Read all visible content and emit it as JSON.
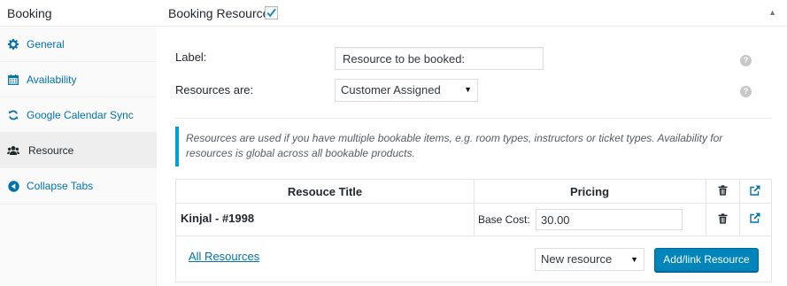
{
  "sidebar": {
    "title": "Booking",
    "tabs": [
      {
        "label": "General",
        "icon": "gear-icon"
      },
      {
        "label": "Availability",
        "icon": "calendar-icon"
      },
      {
        "label": "Google Calendar Sync",
        "icon": "sync-icon"
      },
      {
        "label": "Resource",
        "icon": "users-icon",
        "active": true
      },
      {
        "label": "Collapse Tabs",
        "icon": "collapse-arrow-icon"
      }
    ]
  },
  "header": {
    "title": "Booking Resource:",
    "checked": true,
    "toggle_icon": "triangle-up-icon"
  },
  "form": {
    "label_label": "Label:",
    "label_value": "Resource to be booked:",
    "resources_are_label": "Resources are:",
    "resources_are_value": "Customer Assigned"
  },
  "notice": {
    "text": "Resources are used if you have multiple bookable items, e.g. room types, instructors or ticket types. Availability for resources is global across all bookable products."
  },
  "resource_table": {
    "columns": [
      "Resouce Title",
      "Pricing"
    ],
    "rows": [
      {
        "title": "Kinjal - #1998",
        "base_cost_label": "Base Cost:",
        "base_cost_value": "30.00"
      }
    ],
    "all_resources_link": "All Resources",
    "new_resource_select": "New resource",
    "add_button": "Add/link Resource"
  },
  "colors": {
    "link": "#0073aa",
    "primary_button": "#0085ba",
    "notice_border": "#00a0d2"
  }
}
